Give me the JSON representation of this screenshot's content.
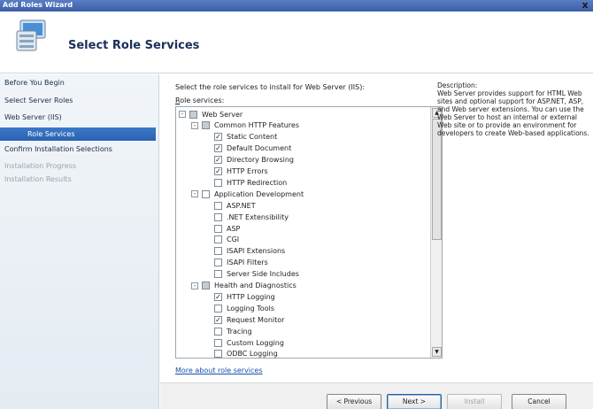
{
  "window": {
    "title": "Add Roles Wizard",
    "close_glyph": "x"
  },
  "header": {
    "title": "Select Role Services",
    "icon": "server-roles-icon"
  },
  "sidebar": {
    "steps": [
      {
        "label": "Before You Begin",
        "state": "normal"
      },
      {
        "label": "Select Server Roles",
        "state": "normal"
      },
      {
        "label": "Web Server (IIS)",
        "state": "normal"
      },
      {
        "label": "Role Services",
        "state": "active"
      },
      {
        "label": "Confirm Installation Selections",
        "state": "normal"
      },
      {
        "label": "Installation Progress",
        "state": "disabled"
      },
      {
        "label": "Installation Results",
        "state": "disabled"
      }
    ]
  },
  "main": {
    "instruction": "Select the role services to install for Web Server (IIS):",
    "role_services_label": "Role services:",
    "role_services_access_key": "R",
    "role_services_rest": "ole services:",
    "tree": [
      {
        "label": "Web Server",
        "checked": "partial",
        "expander": "-"
      },
      {
        "label": "Common HTTP Features",
        "checked": "partial",
        "expander": "-"
      },
      {
        "label": "Static Content",
        "checked": "checked"
      },
      {
        "label": "Default Document",
        "checked": "checked"
      },
      {
        "label": "Directory Browsing",
        "checked": "checked"
      },
      {
        "label": "HTTP Errors",
        "checked": "checked"
      },
      {
        "label": "HTTP Redirection",
        "checked": "unchecked"
      },
      {
        "label": "Application Development",
        "checked": "unchecked",
        "expander": "-"
      },
      {
        "label": "ASP.NET",
        "checked": "unchecked"
      },
      {
        "label": ".NET Extensibility",
        "checked": "unchecked"
      },
      {
        "label": "ASP",
        "checked": "unchecked"
      },
      {
        "label": "CGI",
        "checked": "unchecked"
      },
      {
        "label": "ISAPI Extensions",
        "checked": "unchecked"
      },
      {
        "label": "ISAPI Filters",
        "checked": "unchecked"
      },
      {
        "label": "Server Side Includes",
        "checked": "unchecked"
      },
      {
        "label": "Health and Diagnostics",
        "checked": "partial",
        "expander": "-"
      },
      {
        "label": "HTTP Logging",
        "checked": "checked"
      },
      {
        "label": "Logging Tools",
        "checked": "unchecked"
      },
      {
        "label": "Request Monitor",
        "checked": "checked"
      },
      {
        "label": "Tracing",
        "checked": "unchecked"
      },
      {
        "label": "Custom Logging",
        "checked": "unchecked"
      },
      {
        "label": "ODBC Logging",
        "checked": "unchecked"
      }
    ],
    "description_heading": "Description:",
    "description_body": "Web Server provides support for HTML Web sites and optional support for ASP.NET, ASP, and Web server extensions. You can use the Web Server to host an internal or external Web site or to provide an environment for developers to create Web-based applications.",
    "more_link": "More about role services"
  },
  "buttons": {
    "previous": "< Previous",
    "next": "Next >",
    "install": "Install",
    "cancel": "Cancel"
  }
}
